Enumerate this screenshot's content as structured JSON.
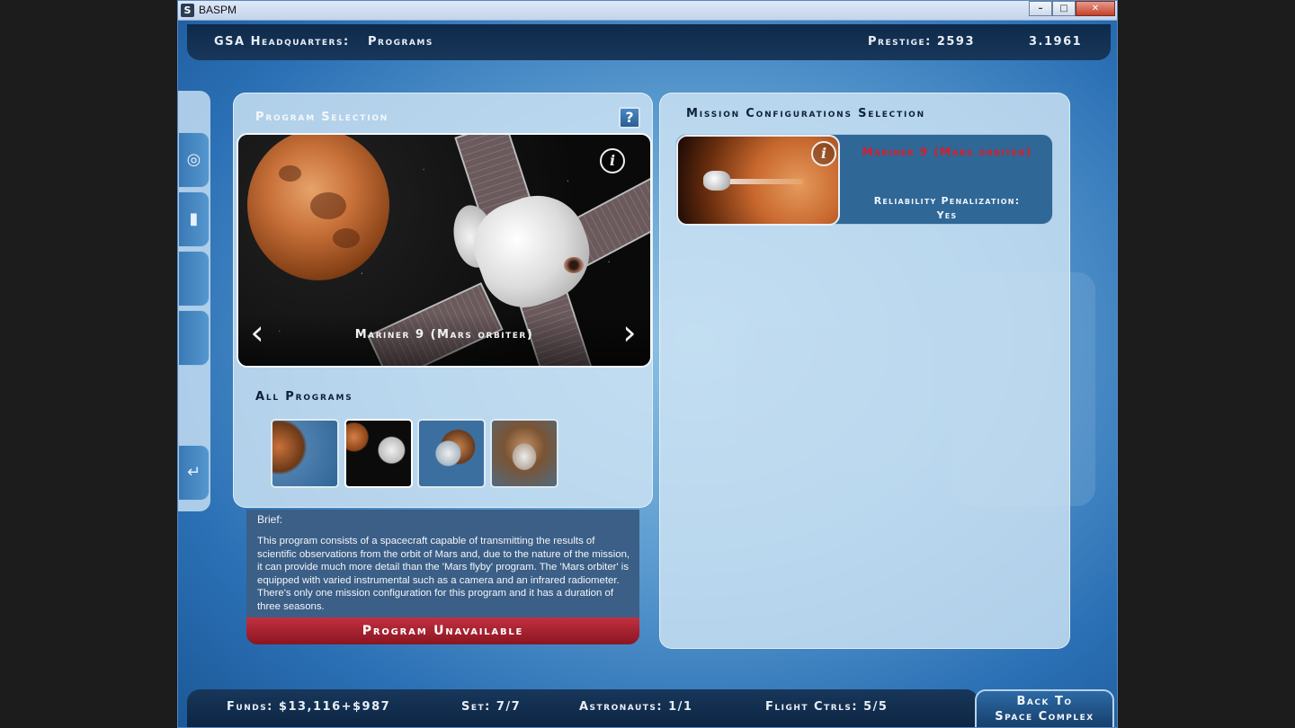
{
  "window": {
    "title": "BASPM",
    "controls": [
      "–",
      "□",
      "✕"
    ]
  },
  "header": {
    "breadcrumb_section": "GSA Headquarters:",
    "breadcrumb_page": "Programs",
    "prestige": "Prestige: 2593",
    "version": "3.1961"
  },
  "sidebar": {
    "icons": [
      "target-icon",
      "document-icon",
      "blank-tab",
      "blank-tab",
      "return-icon"
    ]
  },
  "program_selection": {
    "title": "Program Selection",
    "help_label": "?",
    "info_label": "i",
    "selected_program": "Mariner 9 (Mars orbiter)",
    "prev_arrow": "‹",
    "next_arrow": "›",
    "all_programs_title": "All Programs",
    "selected_thumb_index": 1
  },
  "brief": {
    "label": "Brief:",
    "text": "This program consists of a spacecraft capable of transmitting the results of scientific observations from the orbit of Mars and, due to the nature of the mission, it can provide much more detail than the 'Mars flyby' program. The 'Mars orbiter' is equipped with varied instrumental such as a camera and an infrared radiometer. There's only one mission configuration for this program and it has a duration of three seasons.",
    "status_button": "Program Unavailable"
  },
  "mission_config": {
    "title": "Mission Configurations Selection",
    "info_label": "i",
    "mission_name": "Mariner 9 (Mars orbiter)",
    "penalty_label": "Reliability Penalization:",
    "penalty_value": "Yes"
  },
  "footer": {
    "funds": "Funds: $13,116+$987",
    "set": "Set: 7/7",
    "astronauts": "Astronauts: 1/1",
    "flight_ctrls": "Flight Ctrls: 5/5",
    "back_line1": "Back To",
    "back_line2": "Space Complex"
  },
  "colors": {
    "accent_red": "#d81e2c",
    "bar_dark": "#0e2a4a",
    "panel_light": "#cee4f4"
  }
}
